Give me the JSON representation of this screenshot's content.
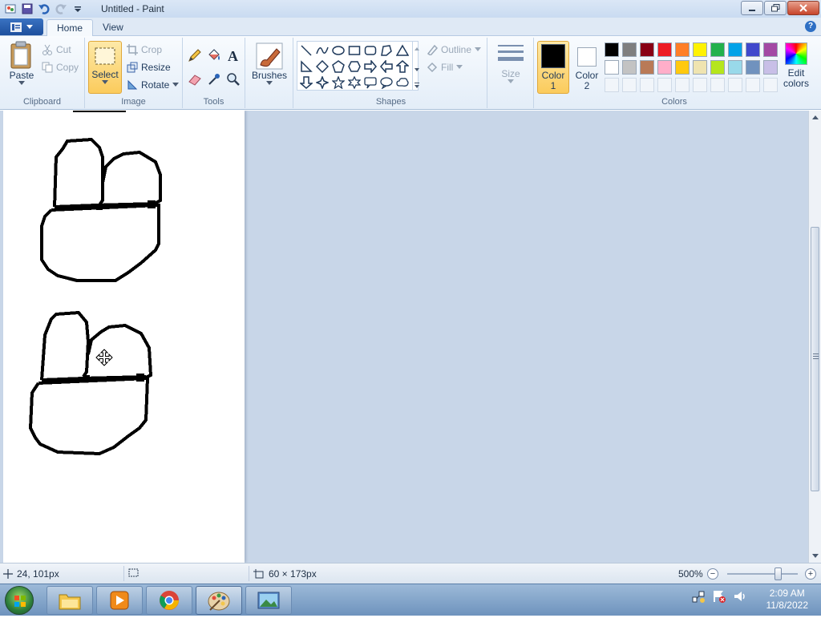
{
  "window": {
    "title": "Untitled - Paint"
  },
  "tabs": {
    "home": "Home",
    "view": "View"
  },
  "ribbon": {
    "clipboard": {
      "paste": "Paste",
      "cut": "Cut",
      "copy": "Copy",
      "label": "Clipboard"
    },
    "image": {
      "select": "Select",
      "crop": "Crop",
      "resize": "Resize",
      "rotate": "Rotate",
      "label": "Image"
    },
    "tools": {
      "label": "Tools"
    },
    "brushes": {
      "label": "Brushes"
    },
    "shapes": {
      "outline": "Outline",
      "fill": "Fill",
      "label": "Shapes"
    },
    "size": {
      "label": "Size"
    },
    "colors": {
      "color1": "Color",
      "color1_num": "1",
      "color2": "Color",
      "color2_num": "2",
      "edit": "Edit",
      "edit2": "colors",
      "label": "Colors",
      "primary": "#000000",
      "secondary": "#ffffff",
      "palette_row1": [
        "#000000",
        "#7f7f7f",
        "#880015",
        "#ed1c24",
        "#ff7f27",
        "#fff200",
        "#22b14c",
        "#00a2e8",
        "#3f48cc",
        "#a349a4"
      ],
      "palette_row2": [
        "#ffffff",
        "#c3c3c3",
        "#b97a57",
        "#ffaec9",
        "#ffc90e",
        "#efe4b0",
        "#b5e61d",
        "#99d9ea",
        "#7092be",
        "#c8bfe7"
      ]
    }
  },
  "status": {
    "cursor_pos": "24, 101px",
    "selection_size": "60 × 173px",
    "zoom": "500%"
  },
  "taskbar": {
    "time": "2:09 AM",
    "date": "11/8/2022"
  }
}
